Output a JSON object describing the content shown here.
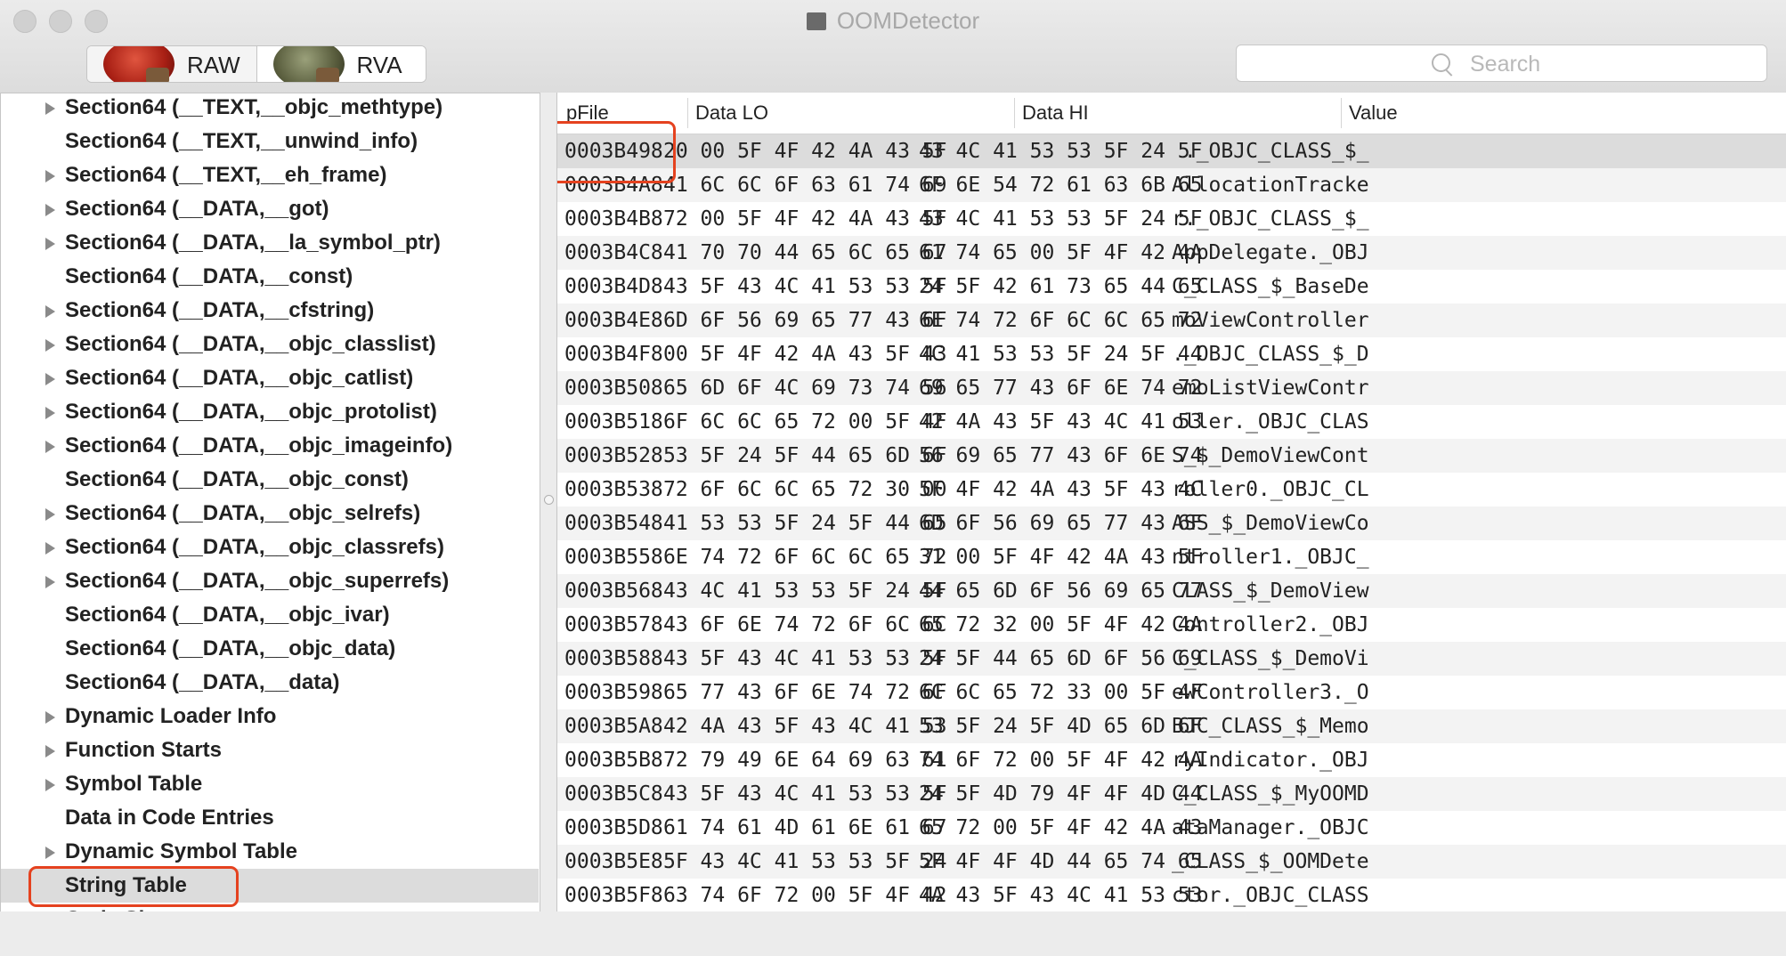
{
  "window": {
    "title": "OOMDetector"
  },
  "toolbar": {
    "segments": [
      {
        "label": "RAW",
        "icon": "apple-icon"
      },
      {
        "label": "RVA",
        "icon": "apple-icon"
      }
    ],
    "search": {
      "placeholder": "Search",
      "value": ""
    }
  },
  "sidebar": {
    "items": [
      {
        "label": "Section64 (__TEXT,__objc_methtype)",
        "expandable": true
      },
      {
        "label": "Section64 (__TEXT,__unwind_info)",
        "expandable": false
      },
      {
        "label": "Section64 (__TEXT,__eh_frame)",
        "expandable": true
      },
      {
        "label": "Section64 (__DATA,__got)",
        "expandable": true
      },
      {
        "label": "Section64 (__DATA,__la_symbol_ptr)",
        "expandable": true
      },
      {
        "label": "Section64 (__DATA,__const)",
        "expandable": false
      },
      {
        "label": "Section64 (__DATA,__cfstring)",
        "expandable": true
      },
      {
        "label": "Section64 (__DATA,__objc_classlist)",
        "expandable": true
      },
      {
        "label": "Section64 (__DATA,__objc_catlist)",
        "expandable": true
      },
      {
        "label": "Section64 (__DATA,__objc_protolist)",
        "expandable": true
      },
      {
        "label": "Section64 (__DATA,__objc_imageinfo)",
        "expandable": true
      },
      {
        "label": "Section64 (__DATA,__objc_const)",
        "expandable": false
      },
      {
        "label": "Section64 (__DATA,__objc_selrefs)",
        "expandable": true
      },
      {
        "label": "Section64 (__DATA,__objc_classrefs)",
        "expandable": true
      },
      {
        "label": "Section64 (__DATA,__objc_superrefs)",
        "expandable": true
      },
      {
        "label": "Section64 (__DATA,__objc_ivar)",
        "expandable": false
      },
      {
        "label": "Section64 (__DATA,__objc_data)",
        "expandable": false
      },
      {
        "label": "Section64 (__DATA,__data)",
        "expandable": false
      },
      {
        "label": "Dynamic Loader Info",
        "expandable": true
      },
      {
        "label": "Function Starts",
        "expandable": true
      },
      {
        "label": "Symbol Table",
        "expandable": true
      },
      {
        "label": "Data in Code Entries",
        "expandable": false
      },
      {
        "label": "Dynamic Symbol Table",
        "expandable": true
      },
      {
        "label": "String Table",
        "expandable": false,
        "selected": true
      },
      {
        "label": "Code Signature",
        "expandable": false
      }
    ]
  },
  "table": {
    "columns": [
      "pFile",
      "Data LO",
      "Data HI",
      "Value"
    ],
    "rows": [
      [
        "0003B498",
        "20 00 5F 4F 42 4A 43 5F",
        "43 4C 41 53 53 5F 24 5F",
        " ._OBJC_CLASS_$_"
      ],
      [
        "0003B4A8",
        "41 6C 6C 6F 63 61 74 69",
        "6F 6E 54 72 61 63 6B 65",
        "AllocationTracke"
      ],
      [
        "0003B4B8",
        "72 00 5F 4F 42 4A 43 5F",
        "43 4C 41 53 53 5F 24 5F",
        "r._OBJC_CLASS_$_"
      ],
      [
        "0003B4C8",
        "41 70 70 44 65 6C 65 67",
        "61 74 65 00 5F 4F 42 4A",
        "AppDelegate._OBJ"
      ],
      [
        "0003B4D8",
        "43 5F 43 4C 41 53 53 5F",
        "24 5F 42 61 73 65 44 65",
        "C_CLASS_$_BaseDe"
      ],
      [
        "0003B4E8",
        "6D 6F 56 69 65 77 43 6F",
        "6E 74 72 6F 6C 6C 65 72",
        "moViewController"
      ],
      [
        "0003B4F8",
        "00 5F 4F 42 4A 43 5F 43",
        "4C 41 53 53 5F 24 5F 44",
        "._OBJC_CLASS_$_D"
      ],
      [
        "0003B508",
        "65 6D 6F 4C 69 73 74 56",
        "69 65 77 43 6F 6E 74 72",
        "emoListViewContr"
      ],
      [
        "0003B518",
        "6F 6C 6C 65 72 00 5F 4F",
        "42 4A 43 5F 43 4C 41 53",
        "oller._OBJC_CLAS"
      ],
      [
        "0003B528",
        "53 5F 24 5F 44 65 6D 6F",
        "56 69 65 77 43 6F 6E 74",
        "S_$_DemoViewCont"
      ],
      [
        "0003B538",
        "72 6F 6C 6C 65 72 30 00",
        "5F 4F 42 4A 43 5F 43 4C",
        "roller0._OBJC_CL"
      ],
      [
        "0003B548",
        "41 53 53 5F 24 5F 44 65",
        "6D 6F 56 69 65 77 43 6F",
        "ASS_$_DemoViewCo"
      ],
      [
        "0003B558",
        "6E 74 72 6F 6C 6C 65 72",
        "31 00 5F 4F 42 4A 43 5F",
        "ntroller1._OBJC_"
      ],
      [
        "0003B568",
        "43 4C 41 53 53 5F 24 5F",
        "44 65 6D 6F 56 69 65 77",
        "CLASS_$_DemoView"
      ],
      [
        "0003B578",
        "43 6F 6E 74 72 6F 6C 6C",
        "65 72 32 00 5F 4F 42 4A",
        "Controller2._OBJ"
      ],
      [
        "0003B588",
        "43 5F 43 4C 41 53 53 5F",
        "24 5F 44 65 6D 6F 56 69",
        "C_CLASS_$_DemoVi"
      ],
      [
        "0003B598",
        "65 77 43 6F 6E 74 72 6F",
        "6C 6C 65 72 33 00 5F 4F",
        "ewController3._O"
      ],
      [
        "0003B5A8",
        "42 4A 43 5F 43 4C 41 53",
        "53 5F 24 5F 4D 65 6D 6F",
        "BJC_CLASS_$_Memo"
      ],
      [
        "0003B5B8",
        "72 79 49 6E 64 69 63 61",
        "74 6F 72 00 5F 4F 42 4A",
        "ryIndicator._OBJ"
      ],
      [
        "0003B5C8",
        "43 5F 43 4C 41 53 53 5F",
        "24 5F 4D 79 4F 4F 4D 44",
        "C_CLASS_$_MyOOMD"
      ],
      [
        "0003B5D8",
        "61 74 61 4D 61 6E 61 67",
        "65 72 00 5F 4F 42 4A 43",
        "ataManager._OBJC"
      ],
      [
        "0003B5E8",
        "5F 43 4C 41 53 53 5F 24",
        "5F 4F 4F 4D 44 65 74 65",
        "_CLASS_$_OOMDete"
      ],
      [
        "0003B5F8",
        "63 74 6F 72 00 5F 4F 42",
        "4A 43 5F 43 4C 41 53 53",
        "ctor._OBJC_CLASS"
      ]
    ]
  },
  "colors": {
    "highlight": "#e5421f",
    "selection": "#dcdcdc"
  }
}
